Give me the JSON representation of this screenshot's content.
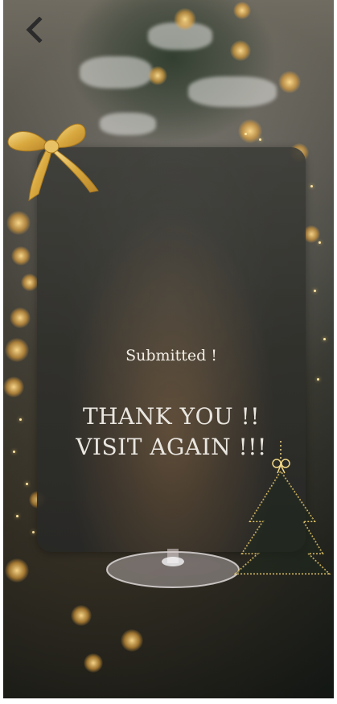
{
  "header": {
    "back_icon": "chevron-left-icon"
  },
  "card": {
    "status_text": "Submitted !",
    "message_line_1": "THANK YOU !!",
    "message_line_2": "VISIT AGAIN !!!"
  },
  "decorations": {
    "ribbon": "gold-bow",
    "tree": "christmas-tree-outline",
    "accent_color": "#d8b45a"
  }
}
